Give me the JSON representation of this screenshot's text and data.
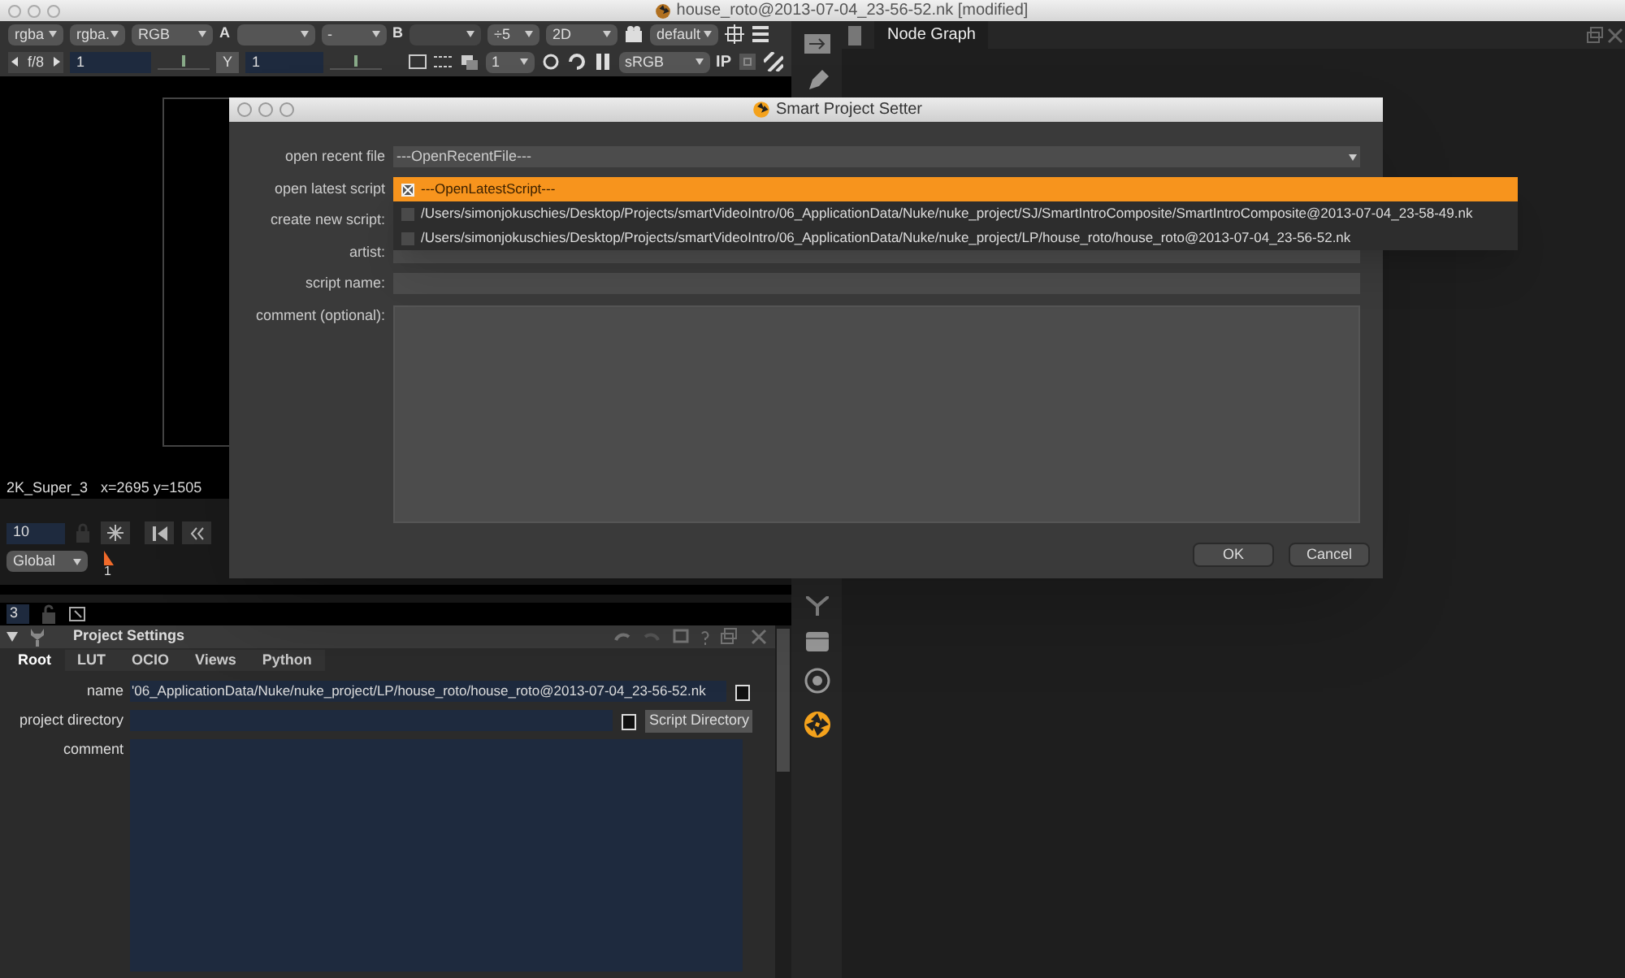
{
  "window": {
    "title": "house_roto@2013-07-04_23-56-52.nk [modified]"
  },
  "viewer_toolbar": {
    "row_1": {
      "channels": "rgba",
      "layer": "rgba.",
      "channel": "RGB",
      "a_label": "A",
      "operation": "-",
      "b_label": "B",
      "zoom": "÷5",
      "view_mode": "2D",
      "lut": "default"
    },
    "row_2": {
      "fstop": "f/8",
      "gain": "1",
      "gain_slider": {
        "level": 0.5
      },
      "gamma_label": "Y",
      "gamma": "1",
      "gamma_slider": {
        "level": 0.5
      },
      "proxy": "1",
      "colorspace": "sRGB",
      "ip": "IP"
    }
  },
  "viewer": {
    "format": "2K_Super_3",
    "coords": "x=2695 y=1505",
    "frame": "10",
    "range": "Global",
    "timeline_label": "1",
    "lower_field": "3"
  },
  "project_settings": {
    "title": "Project Settings",
    "tabs": [
      {
        "label": "Root",
        "selected": true
      },
      {
        "label": "LUT",
        "selected": false
      },
      {
        "label": "OCIO",
        "selected": false
      },
      {
        "label": "Views",
        "selected": false
      },
      {
        "label": "Python",
        "selected": false
      }
    ],
    "name_label": "name",
    "name_value": "'06_ApplicationData/Nuke/nuke_project/LP/house_roto/house_roto@2013-07-04_23-56-52.nk",
    "directory_label": "project directory",
    "directory_button": "Script Directory",
    "comment_label": "comment"
  },
  "node_graph": {
    "tab": "Node Graph"
  },
  "dialog": {
    "title": "Smart Project Setter",
    "recent_label": "open recent file",
    "recent_value": "---OpenRecentFile---",
    "latest_label": "open latest script",
    "create_label": "create new script:",
    "artist_label": "artist:",
    "script_name_label": "script name:",
    "comment_label": "comment (optional):",
    "buttons": [
      "OK",
      "Cancel"
    ],
    "popup": [
      {
        "label": "---OpenLatestScript---",
        "selected": true,
        "checked": true
      },
      {
        "label": "/Users/simonjokuschies/Desktop/Projects/smartVideoIntro/06_ApplicationData/Nuke/nuke_project/SJ/SmartIntroComposite/SmartIntroComposite@2013-07-04_23-58-49.nk",
        "selected": false,
        "checked": false
      },
      {
        "label": "/Users/simonjokuschies/Desktop/Projects/smartVideoIntro/06_ApplicationData/Nuke/nuke_project/LP/house_roto/house_roto@2013-07-04_23-56-52.nk",
        "selected": false,
        "checked": false
      }
    ]
  }
}
